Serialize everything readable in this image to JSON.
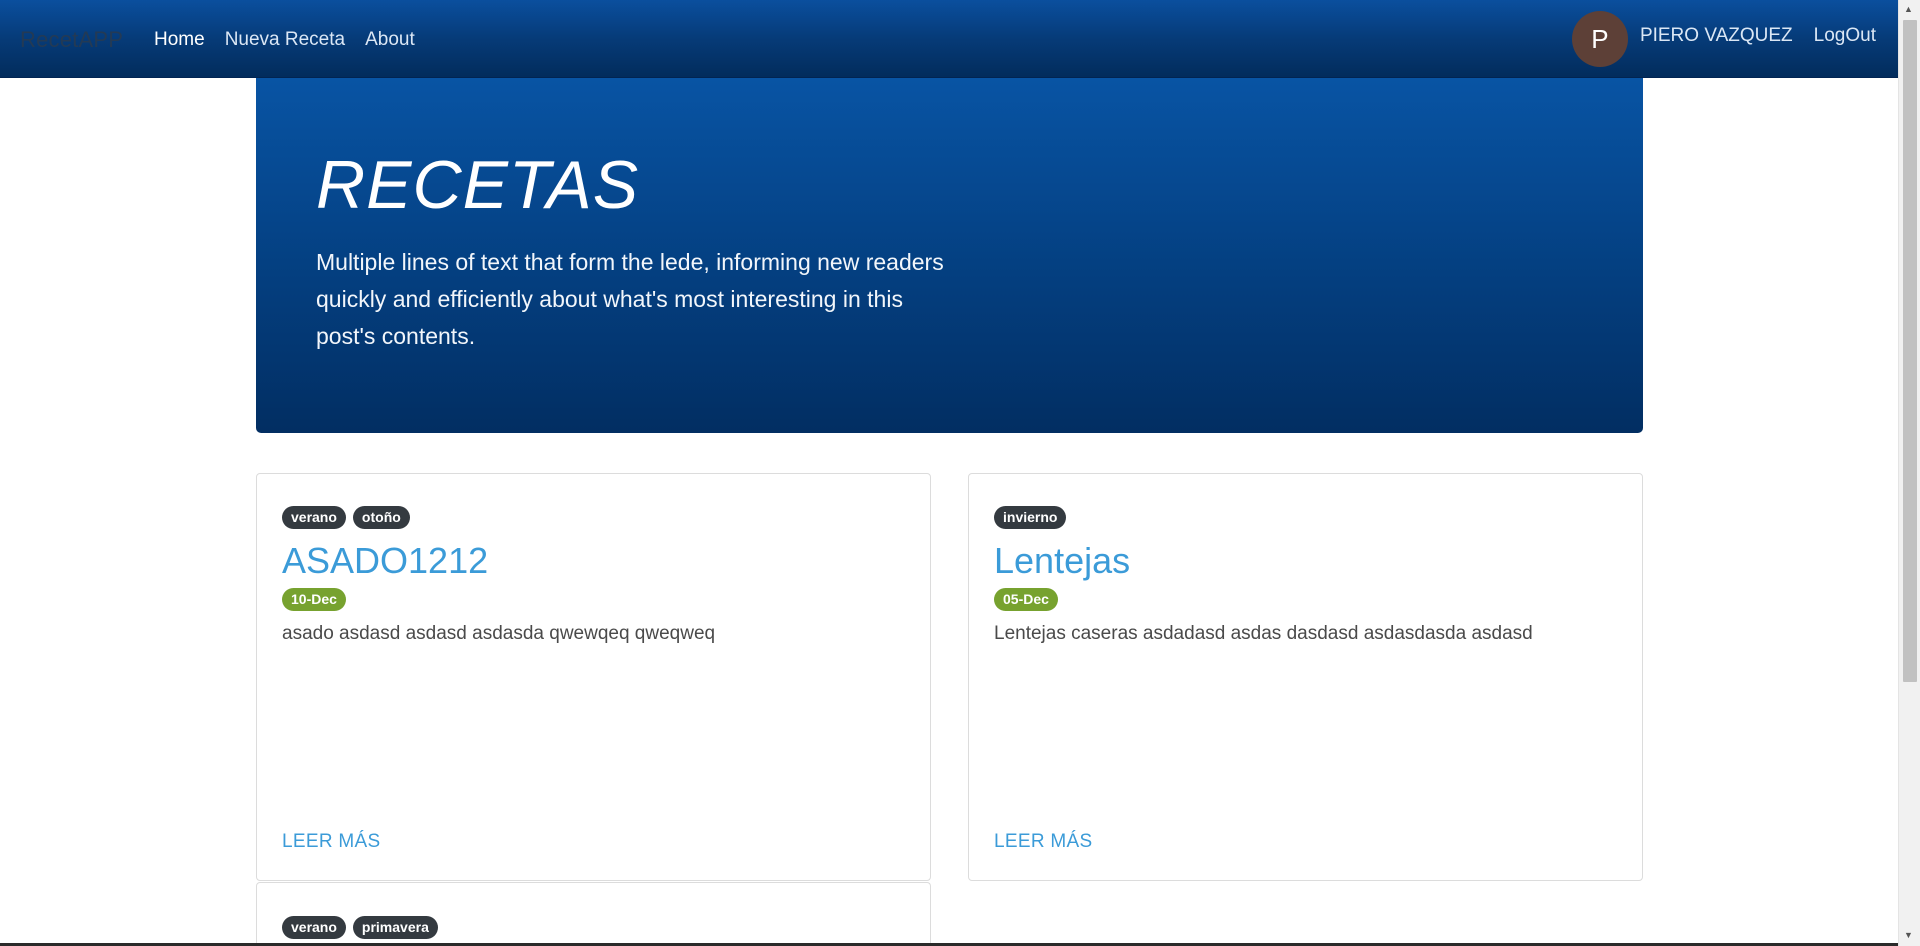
{
  "navbar": {
    "brand": "RecetAPP",
    "links": [
      {
        "label": "Home",
        "active": true
      },
      {
        "label": "Nueva Receta",
        "active": false
      },
      {
        "label": "About",
        "active": false
      }
    ],
    "user": {
      "avatar_letter": "P",
      "avatar_color": "#5d4037",
      "name": "PIERO VAZQUEZ",
      "logout_label": "LogOut"
    }
  },
  "hero": {
    "title": "RECETAS",
    "lede": "Multiple lines of text that form the lede, informing new readers quickly and efficiently about what's most interesting in this post's contents."
  },
  "cards": [
    {
      "tags": [
        "verano",
        "otoño"
      ],
      "title": "ASADO1212",
      "date": "10-Dec",
      "text": "asado asdasd asdasd asdasda qwewqeq qweqweq",
      "read_more": "LEER MÁS"
    },
    {
      "tags": [
        "invierno"
      ],
      "title": "Lentejas",
      "date": "05-Dec",
      "text": "Lentejas caseras asdadasd asdas dasdasd asdasdasda asdasd",
      "read_more": "LEER MÁS"
    },
    {
      "tags": [
        "verano",
        "primavera"
      ]
    }
  ],
  "colors": {
    "navbar": "#063b78",
    "hero": "#043f80",
    "title_link": "#3b9bd8",
    "tag": "#343a40",
    "date_badge": "#77a22f"
  }
}
